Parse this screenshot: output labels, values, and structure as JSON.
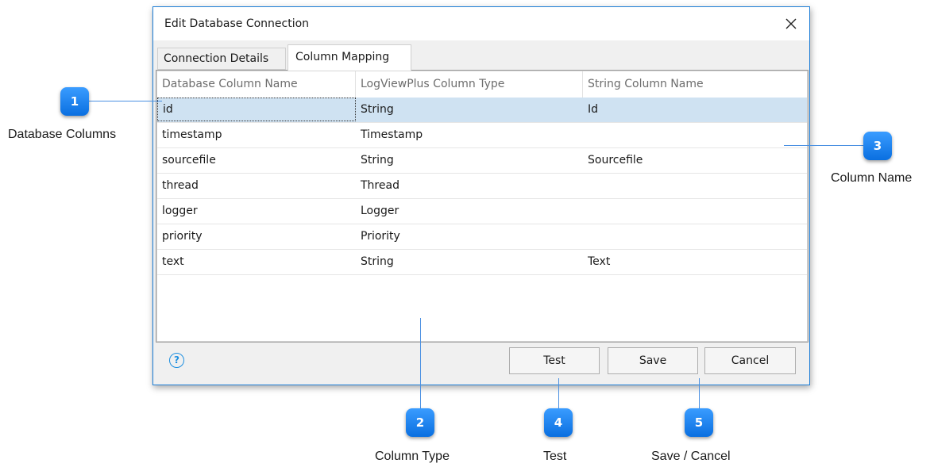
{
  "dialog": {
    "title": "Edit Database Connection",
    "tabs": [
      {
        "label": "Connection Details",
        "active": false
      },
      {
        "label": "Column Mapping",
        "active": true
      }
    ],
    "columns": [
      "Database Column Name",
      "LogViewPlus Column Type",
      "String Column Name"
    ],
    "rows": [
      {
        "db": "id",
        "type": "String",
        "name": "Id",
        "selected": true
      },
      {
        "db": "timestamp",
        "type": "Timestamp",
        "name": ""
      },
      {
        "db": "sourcefile",
        "type": "String",
        "name": "Sourcefile"
      },
      {
        "db": "thread",
        "type": "Thread",
        "name": ""
      },
      {
        "db": "logger",
        "type": "Logger",
        "name": ""
      },
      {
        "db": "priority",
        "type": "Priority",
        "name": ""
      },
      {
        "db": "text",
        "type": "String",
        "name": "Text"
      }
    ],
    "buttons": {
      "test": "Test",
      "save": "Save",
      "cancel": "Cancel"
    },
    "help_icon": "?"
  },
  "callouts": [
    {
      "number": "1",
      "label": "Database Columns"
    },
    {
      "number": "2",
      "label": "Column Type"
    },
    {
      "number": "3",
      "label": "Column Name"
    },
    {
      "number": "4",
      "label": "Test"
    },
    {
      "number": "5",
      "label": "Save / Cancel"
    }
  ],
  "colors": {
    "accent": "#1e7ed6",
    "selected_row": "#cfe2f2",
    "callout": "#0a6fe0"
  }
}
